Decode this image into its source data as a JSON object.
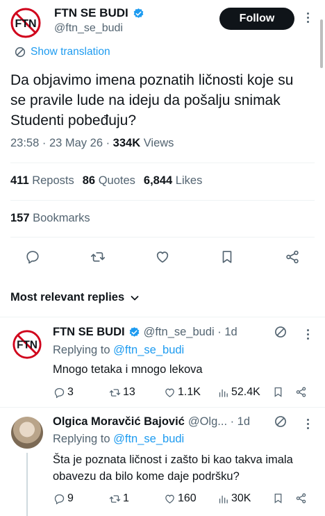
{
  "tweet": {
    "author_name": "FTN SE BUDI",
    "author_handle": "@ftn_se_budi",
    "follow_label": "Follow",
    "show_translation": "Show translation",
    "text": "Da objavimo imena poznatih ličnosti koje su se pravile lude na ideju da pošalju snimak Studenti pobeđuju?",
    "time": "23:58 · 23 May 26 · ",
    "views_count": "334K",
    "views_label": " Views",
    "reposts_count": "411",
    "reposts_label": "Reposts",
    "quotes_count": "86",
    "quotes_label": "Quotes",
    "likes_count": "6,844",
    "likes_label": "Likes",
    "bookmarks_count": "157",
    "bookmarks_label": "Bookmarks",
    "logo_text": "FTN"
  },
  "replies_header": "Most relevant replies",
  "replies": [
    {
      "name": "FTN SE BUDI",
      "handle": "@ftn_se_budi · 1d",
      "replying_prefix": "Replying to ",
      "replying_to": "@ftn_se_budi",
      "text": "Mnogo tetaka i mnogo lekova",
      "comments": "3",
      "reposts": "13",
      "likes": "1.1K",
      "views": "52.4K"
    },
    {
      "name": "Olgica Moravčić Bajović",
      "handle": "@Olg... · 1d",
      "replying_prefix": "Replying to ",
      "replying_to": "@ftn_se_budi",
      "text": "Šta je poznata ličnost i zašto bi kao takva imala obavezu da bilo kome daje podršku?",
      "comments": "9",
      "reposts": "1",
      "likes": "160",
      "views": "30K"
    }
  ],
  "colors": {
    "accent": "#1d9bf0",
    "text": "#0f1419",
    "secondary": "#536471",
    "logo_red": "#d0021b"
  }
}
